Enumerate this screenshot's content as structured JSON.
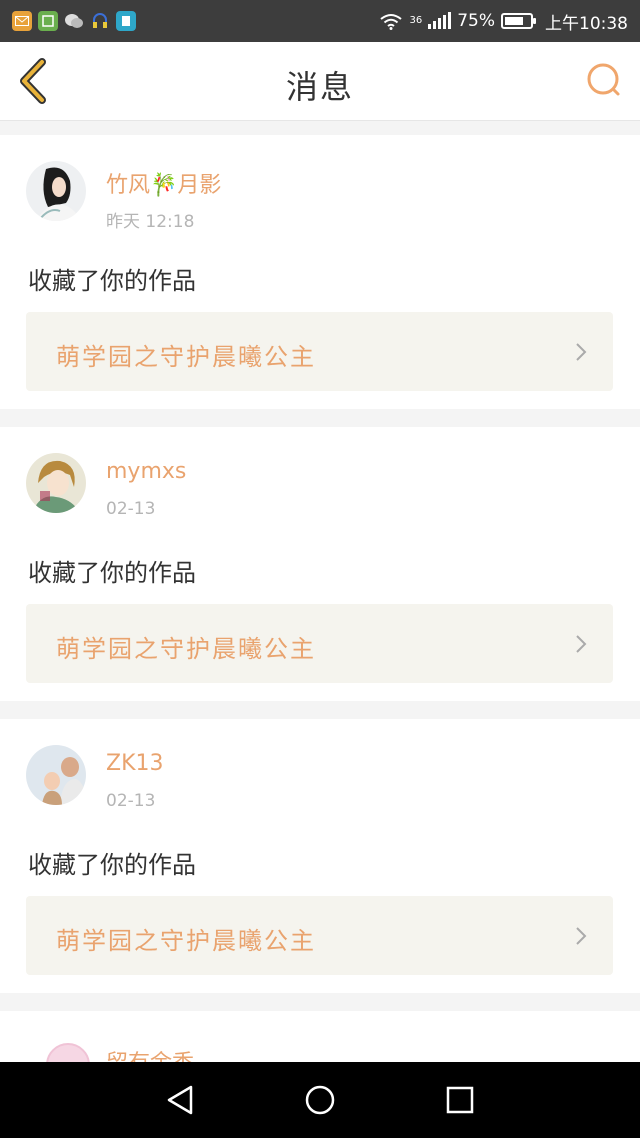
{
  "status_bar": {
    "network": "36",
    "battery": "75%",
    "battery_level": 0.75,
    "time": "上午10:38",
    "app_icons": [
      "mail-app-icon",
      "reader-app-icon",
      "wechat-icon",
      "headset-icon",
      "book-app-icon"
    ]
  },
  "header": {
    "title": "消息",
    "back_icon": "chevron-left-icon",
    "search_icon": "search-icon"
  },
  "messages": [
    {
      "user": "竹风🎋月影",
      "time": "昨天 12:18",
      "action": "收藏了你的作品",
      "work_title": "萌学园之守护晨曦公主"
    },
    {
      "user": "mymxs",
      "time": "02-13",
      "action": "收藏了你的作品",
      "work_title": "萌学园之守护晨曦公主"
    },
    {
      "user": "ZK13",
      "time": "02-13",
      "action": "收藏了你的作品",
      "work_title": "萌学园之守护晨曦公主"
    },
    {
      "user": "留有余香"
    }
  ],
  "nav_bar": {
    "back": "triangle-back-icon",
    "home": "circle-home-icon",
    "recents": "square-recents-icon"
  },
  "colors": {
    "accent": "#e9a36e",
    "header_icon": "#e9b33a",
    "card_link_bg": "#f5f4ee"
  }
}
